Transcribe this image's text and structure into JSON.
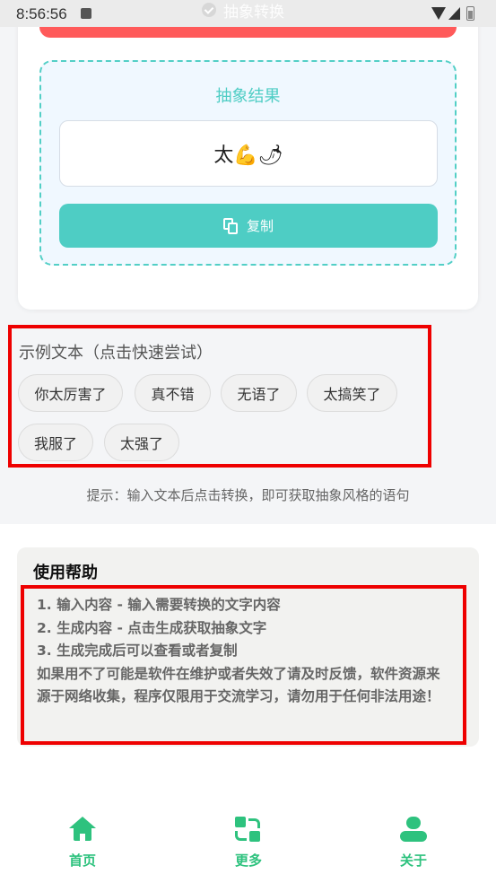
{
  "status_bar": {
    "time": "8:56:56"
  },
  "convert": {
    "label": "抽象转换"
  },
  "result": {
    "title": "抽象结果",
    "output": "太💪🌶",
    "copy_label": "复制"
  },
  "examples": {
    "label": "示例文本（点击快速尝试）",
    "chips": [
      "你太厉害了",
      "真不错",
      "无语了",
      "太搞笑了",
      "我服了",
      "太强了"
    ]
  },
  "hint": "提示：输入文本后点击转换，即可获取抽象风格的语句",
  "help": {
    "title": "使用帮助",
    "lines": [
      "1. 输入内容 - 输入需要转换的文字内容",
      "2. 生成内容 - 点击生成获取抽象文字",
      "3. 生成完成后可以查看或者复制",
      "如果用不了可能是软件在维护或者失效了请及时反馈，软件资源来源于网络收集，程序仅限用于交流学习，请勿用于任何非法用途！"
    ]
  },
  "nav": {
    "items": [
      {
        "label": "首页",
        "icon": "home-icon"
      },
      {
        "label": "更多",
        "icon": "more-icon"
      },
      {
        "label": "关于",
        "icon": "user-icon"
      }
    ]
  },
  "colors": {
    "accent": "#4ecdc4",
    "nav_green": "#2ec27e",
    "convert_red": "#ff5a5a",
    "highlight_red": "#ee0000"
  }
}
